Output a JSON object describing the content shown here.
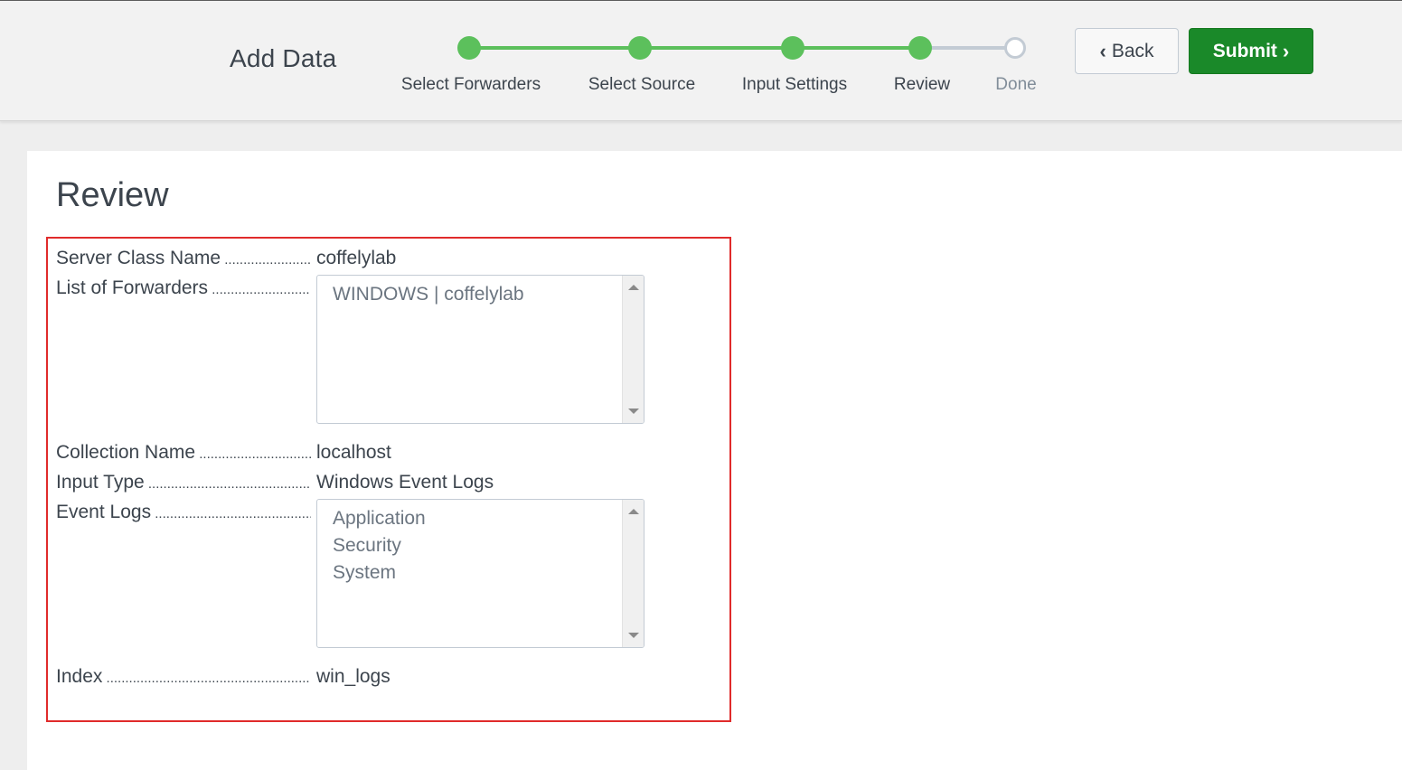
{
  "header": {
    "title": "Add Data",
    "steps": [
      {
        "label": "Select Forwarders",
        "state": "complete"
      },
      {
        "label": "Select Source",
        "state": "complete"
      },
      {
        "label": "Input Settings",
        "state": "complete"
      },
      {
        "label": "Review",
        "state": "current"
      },
      {
        "label": "Done",
        "state": "pending"
      }
    ],
    "back_label": "Back",
    "submit_label": "Submit"
  },
  "review": {
    "title": "Review",
    "server_class_label": "Server Class Name",
    "server_class_value": "coffelylab",
    "forwarders_label": "List of Forwarders",
    "forwarders": [
      "WINDOWS | coffelylab"
    ],
    "collection_label": "Collection Name",
    "collection_value": "localhost",
    "input_type_label": "Input Type",
    "input_type_value": "Windows Event Logs",
    "event_logs_label": "Event Logs",
    "event_logs": [
      "Application",
      "Security",
      "System"
    ],
    "index_label": "Index",
    "index_value": "win_logs"
  },
  "colors": {
    "step_complete": "#5cc05c",
    "step_pending": "#c3cbd4",
    "submit_bg": "#1a8929",
    "highlight": "#e02b2b"
  }
}
